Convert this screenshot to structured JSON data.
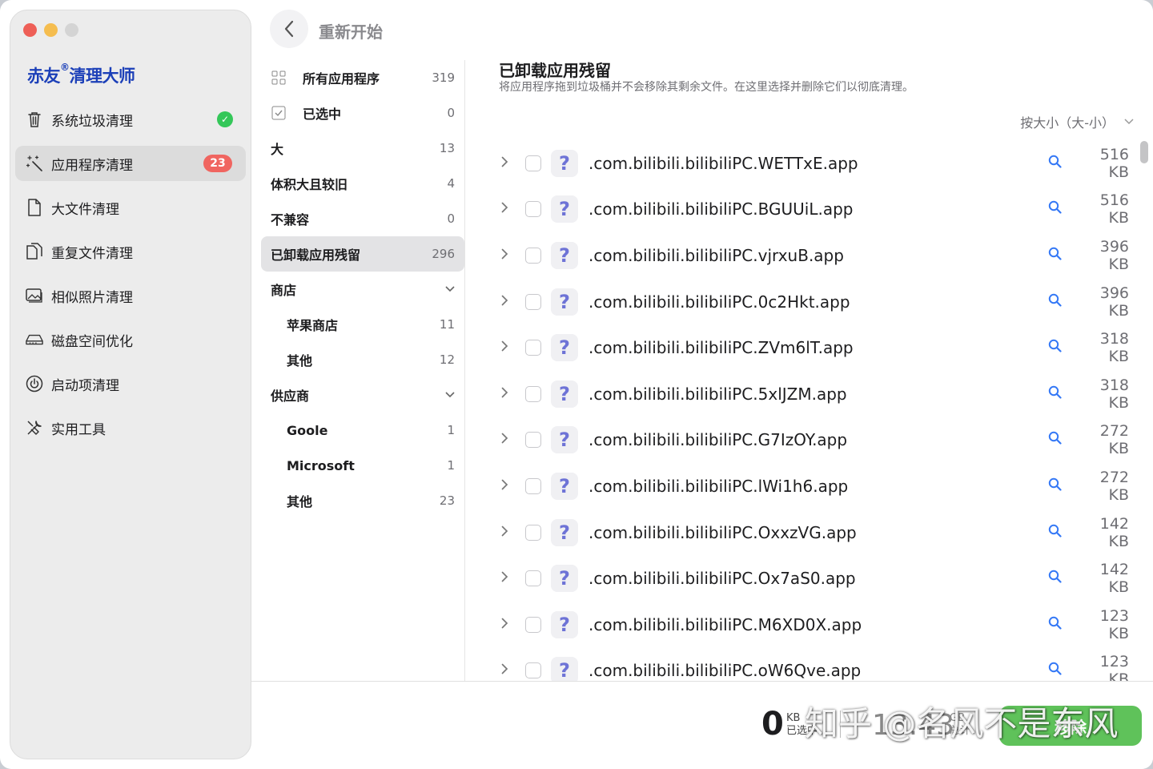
{
  "sidebar": {
    "brand": {
      "name_a": "赤友",
      "mark": "®",
      "name_b": "清理大师"
    },
    "items": [
      {
        "icon": "trash-icon",
        "label": "系统垃圾清理",
        "status": "done"
      },
      {
        "icon": "magic-wand-icon",
        "label": "应用程序清理",
        "badge": "23",
        "active": true
      },
      {
        "icon": "file-icon",
        "label": "大文件清理"
      },
      {
        "icon": "duplicate-files-icon",
        "label": "重复文件清理"
      },
      {
        "icon": "photos-icon",
        "label": "相似照片清理"
      },
      {
        "icon": "disk-icon",
        "label": "磁盘空间优化"
      },
      {
        "icon": "power-icon",
        "label": "启动项清理"
      },
      {
        "icon": "tools-icon",
        "label": "实用工具"
      }
    ]
  },
  "header": {
    "back_icon": "chevron-left-icon",
    "restart_label": "重新开始"
  },
  "categories": {
    "all": {
      "label": "所有应用程序",
      "count": "319"
    },
    "selected": {
      "label": "已选中",
      "count": "0"
    },
    "large": {
      "label": "大",
      "count": "13"
    },
    "large_old": {
      "label": "体积大且较旧",
      "count": "4"
    },
    "incompatible": {
      "label": "不兼容",
      "count": "0"
    },
    "uninstalled": {
      "label": "已卸载应用残留",
      "count": "296"
    },
    "store": {
      "label": "商店"
    },
    "apple_store": {
      "label": "苹果商店",
      "count": "11"
    },
    "store_other": {
      "label": "其他",
      "count": "12"
    },
    "vendor": {
      "label": "供应商"
    },
    "goole": {
      "label": "Goole",
      "count": "1"
    },
    "microsoft": {
      "label": "Microsoft",
      "count": "1"
    },
    "vendor_other": {
      "label": "其他",
      "count": "23"
    }
  },
  "content": {
    "title": "已卸载应用残留",
    "description": "将应用程序拖到垃圾桶并不会移除其剩余文件。在这里选择并删除它们以彻底清理。",
    "sort_label": "按大小（大-小）",
    "rows": [
      {
        "name": ".com.bilibili.bilibiliPC.WETTxE.app",
        "size": "516 KB"
      },
      {
        "name": ".com.bilibili.bilibiliPC.BGUUiL.app",
        "size": "516 KB"
      },
      {
        "name": ".com.bilibili.bilibiliPC.vjrxuB.app",
        "size": "396 KB"
      },
      {
        "name": ".com.bilibili.bilibiliPC.0c2Hkt.app",
        "size": "396 KB"
      },
      {
        "name": ".com.bilibili.bilibiliPC.ZVm6lT.app",
        "size": "318 KB"
      },
      {
        "name": ".com.bilibili.bilibiliPC.5xlJZM.app",
        "size": "318 KB"
      },
      {
        "name": ".com.bilibili.bilibiliPC.G7IzOY.app",
        "size": "272 KB"
      },
      {
        "name": ".com.bilibili.bilibiliPC.lWi1h6.app",
        "size": "272 KB"
      },
      {
        "name": ".com.bilibili.bilibiliPC.OxxzVG.app",
        "size": "142 KB"
      },
      {
        "name": ".com.bilibili.bilibiliPC.Ox7aS0.app",
        "size": "142 KB"
      },
      {
        "name": ".com.bilibili.bilibiliPC.M6XD0X.app",
        "size": "123 KB"
      },
      {
        "name": ".com.bilibili.bilibiliPC.oW6Qve.app",
        "size": "123 KB"
      }
    ]
  },
  "footer": {
    "selected_value": "0",
    "selected_unit": "KB",
    "selected_label": "已选中",
    "total_value": "13.43",
    "total_unit": "GB",
    "total_label": "总计",
    "clean_label": "移除"
  },
  "watermark": "知乎 @名风不是东风",
  "colors": {
    "brand": "#1b3fb8",
    "badge": "#f06560",
    "check": "#34c759",
    "search": "#3478f6",
    "primary_button": "#5fc25a",
    "row_icon": "#6e73d6"
  }
}
